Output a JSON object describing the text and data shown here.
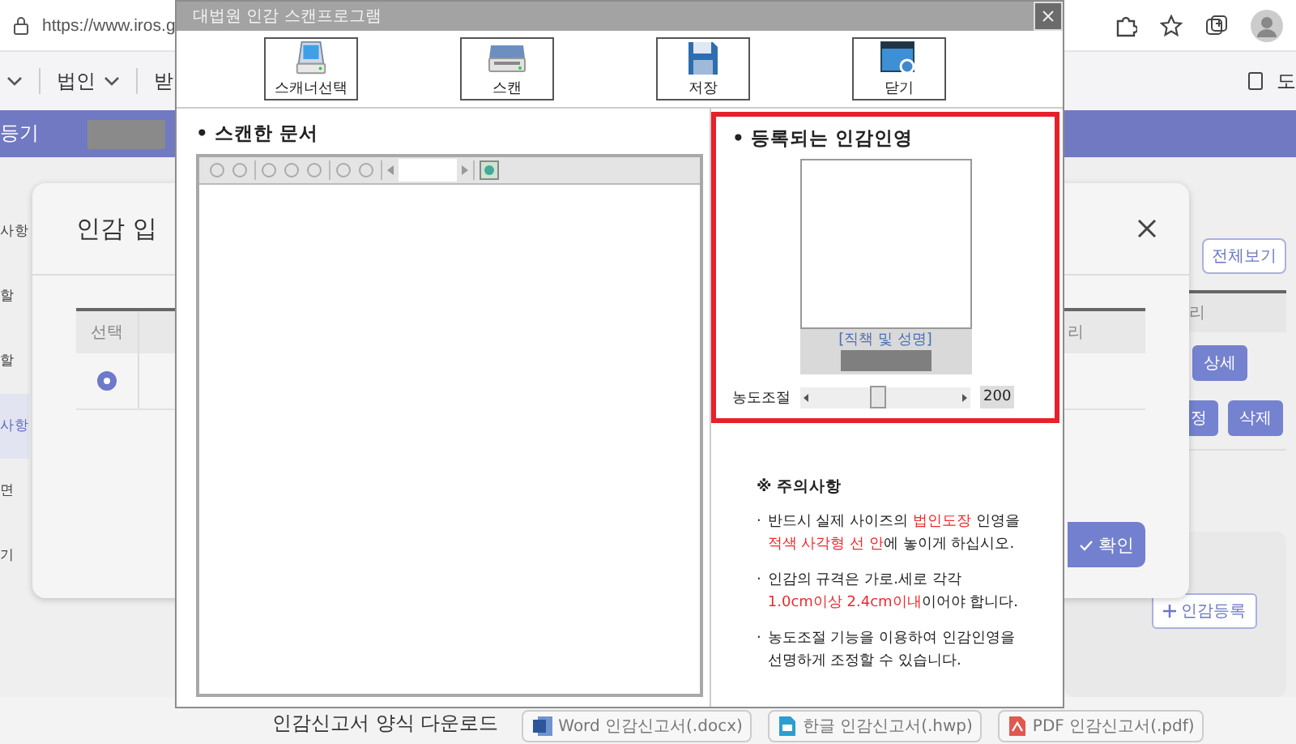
{
  "browser": {
    "url": "https://www.iros.g"
  },
  "nav": {
    "menus": [
      "법인",
      "받"
    ],
    "right_link": "도"
  },
  "banner": {
    "title": "등기"
  },
  "sidebar": [
    {
      "label": "사항",
      "selected": false
    },
    {
      "label": "할",
      "selected": false
    },
    {
      "label": "할",
      "selected": false
    },
    {
      "label": "사항",
      "selected": true
    },
    {
      "label": "면",
      "selected": false
    },
    {
      "label": "기",
      "selected": false
    }
  ],
  "dialog": {
    "title": "인감 입",
    "columns": [
      "선택",
      "리"
    ],
    "rows": [
      {
        "selected": true
      }
    ],
    "confirm": "확인"
  },
  "side_panel": {
    "view_all": "전체보기",
    "column": "리",
    "buttons": [
      "상세",
      "정",
      "삭제"
    ],
    "register": "인감등록"
  },
  "downloads": {
    "label": "인감신고서 양식 다운로드",
    "files": [
      {
        "kind": "word",
        "label": "Word 인감신고서(.docx)"
      },
      {
        "kind": "hwp",
        "label": "한글 인감신고서(.hwp)"
      },
      {
        "kind": "pdf",
        "label": "PDF 인감신고서(.pdf)"
      }
    ]
  },
  "scanner": {
    "title": "대법원 인감 스캔프로그램",
    "tools": [
      {
        "kind": "scanner",
        "label": "스캐너선택"
      },
      {
        "kind": "scan",
        "label": "스캔"
      },
      {
        "kind": "save",
        "label": "저장"
      },
      {
        "kind": "close",
        "label": "닫기"
      }
    ],
    "doc_heading": "• 스캔한 문서",
    "seal_heading": "• 등록되는 인감인영",
    "caption": "[직책 및 성명]",
    "slider": {
      "label": "농도조절",
      "level": 0.45,
      "reading": "200"
    },
    "notice": {
      "title": "※ 주의사항",
      "items": [
        {
          "bullet": "·",
          "lines": [
            [
              {
                "text": "반드시 실제 사이즈의 ",
                "red": false
              },
              {
                "text": "법인도장",
                "red": true
              },
              {
                "text": " 인영을",
                "red": false
              }
            ],
            [
              {
                "text": "적색 사각형 선 안",
                "red": true
              },
              {
                "text": "에 놓이게 하십시오.",
                "red": false
              }
            ]
          ]
        },
        {
          "bullet": "·",
          "lines": [
            [
              {
                "text": "인감의 규격은 가로.세로 각각",
                "red": false
              }
            ],
            [
              {
                "text": "1.0cm이상 2.4cm이내",
                "red": true
              },
              {
                "text": "이어야 합니다.",
                "red": false
              }
            ]
          ]
        },
        {
          "bullet": "·",
          "lines": [
            [
              {
                "text": "농도조절 기능을 이용하여 인감인영을",
                "red": false
              }
            ],
            [
              {
                "text": "선명하게 조정할 수 있습니다.",
                "red": false
              }
            ]
          ]
        }
      ]
    }
  }
}
